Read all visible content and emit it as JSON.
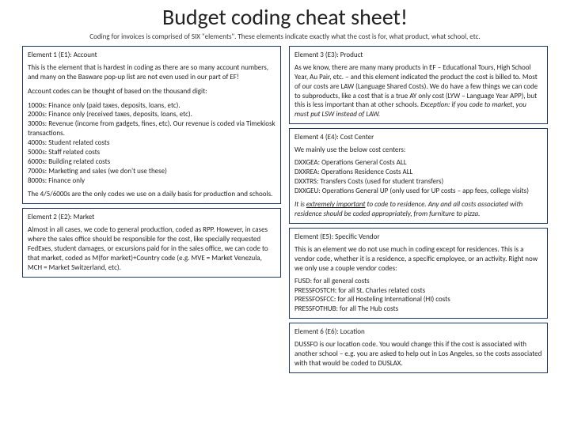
{
  "header": {
    "title": "Budget coding cheat sheet!",
    "subtitle": "Coding for invoices is comprised of SIX \"elements\". These elements indicate exactly what the cost is for, what product, what school, etc."
  },
  "left": {
    "e1": {
      "title": "Element 1 (E1): Account",
      "p1": "This is the element that is hardest in coding as there are so many account numbers, and many on the Basware pop-up list are not even used in our part of EF!",
      "p2": "Account codes can be thought of based on the thousand digit:",
      "p3": "1000s: Finance only (paid taxes, deposits, loans, etc).\n2000s: Finance only (received taxes, deposits, loans, etc).\n3000s: Revenue (income from gadgets, fines, etc). Our revenue is coded via Timekiosk transactions.\n4000s: Student related costs\n5000s: Staff related costs\n6000s: Building related costs\n7000s: Marketing and sales (we don't use these)\n8000s: Finance only",
      "p4": "The 4/5/6000s are the only codes we use on a daily basis for production and schools."
    },
    "e2": {
      "title": "Element 2 (E2): Market",
      "p1": "Almost in all cases, we code to general production, coded as RPP. However, in cases where the sales office should be responsible for the cost, like specially requested FedExes, student damages, or excursions paid for in the sales office, we can code to that market, coded as M(for market)+Country code (e.g. MVE = Market Venezula, MCH = Market Switzerland, etc)."
    }
  },
  "right": {
    "e3": {
      "title": "Element 3 (E3): Product",
      "p1_a": "As we know, there are many many products in EF – Educational Tours, High School Year, Au Pair, etc. – and this element indicated the product the cost is billed to. Most of our costs are LAW (Language Shared Costs). We do have a few things we can code to subproducts, like a cost that is a true AY only cost (LYW – Language Year APP), but this is less important than at other schools. ",
      "p1_b": "Exception: if you code to market, you must put LSW instead of LAW."
    },
    "e4": {
      "title": "Element 4 (E4): Cost Center",
      "p1": "We mainly use the below cost centers:",
      "p2": "DXXGEA: Operations General Costs ALL\nDXXREA: Operations Residence Costs ALL\nDXXTRS: Transfers Costs (used for student transfers)\nDXXGEU: Operations General UP (only used for UP costs – app fees, college visits)",
      "p3_a": "It is ",
      "p3_b": "extremely important",
      "p3_c": " to code to residence. Any and all costs associated with residence should be coded appropriately, from furniture to pizza."
    },
    "e5": {
      "title": "Element (E5): Specific Vendor",
      "p1": "This is an element we do not use much in coding except for residences. This is a vendor code, whether it is a residence, a specific employee, or an activity. Right now we only use a couple vendor codes:",
      "p2": "FUSD: for all general costs\nPRESSFOSTCH: for all St. Charles related costs\nPRESSFOSFCC: for all Hosteling International (HI) costs\nPRESSFOTHUB: for all The Hub costs"
    },
    "e6": {
      "title": "Element 6 (E6): Location",
      "p1": "DUSSFO is our location code. You would change this if the cost is associated with another school – e.g. you are asked to help out in Los Angeles, so the costs associated with that would be coded to DUSLAX."
    }
  }
}
